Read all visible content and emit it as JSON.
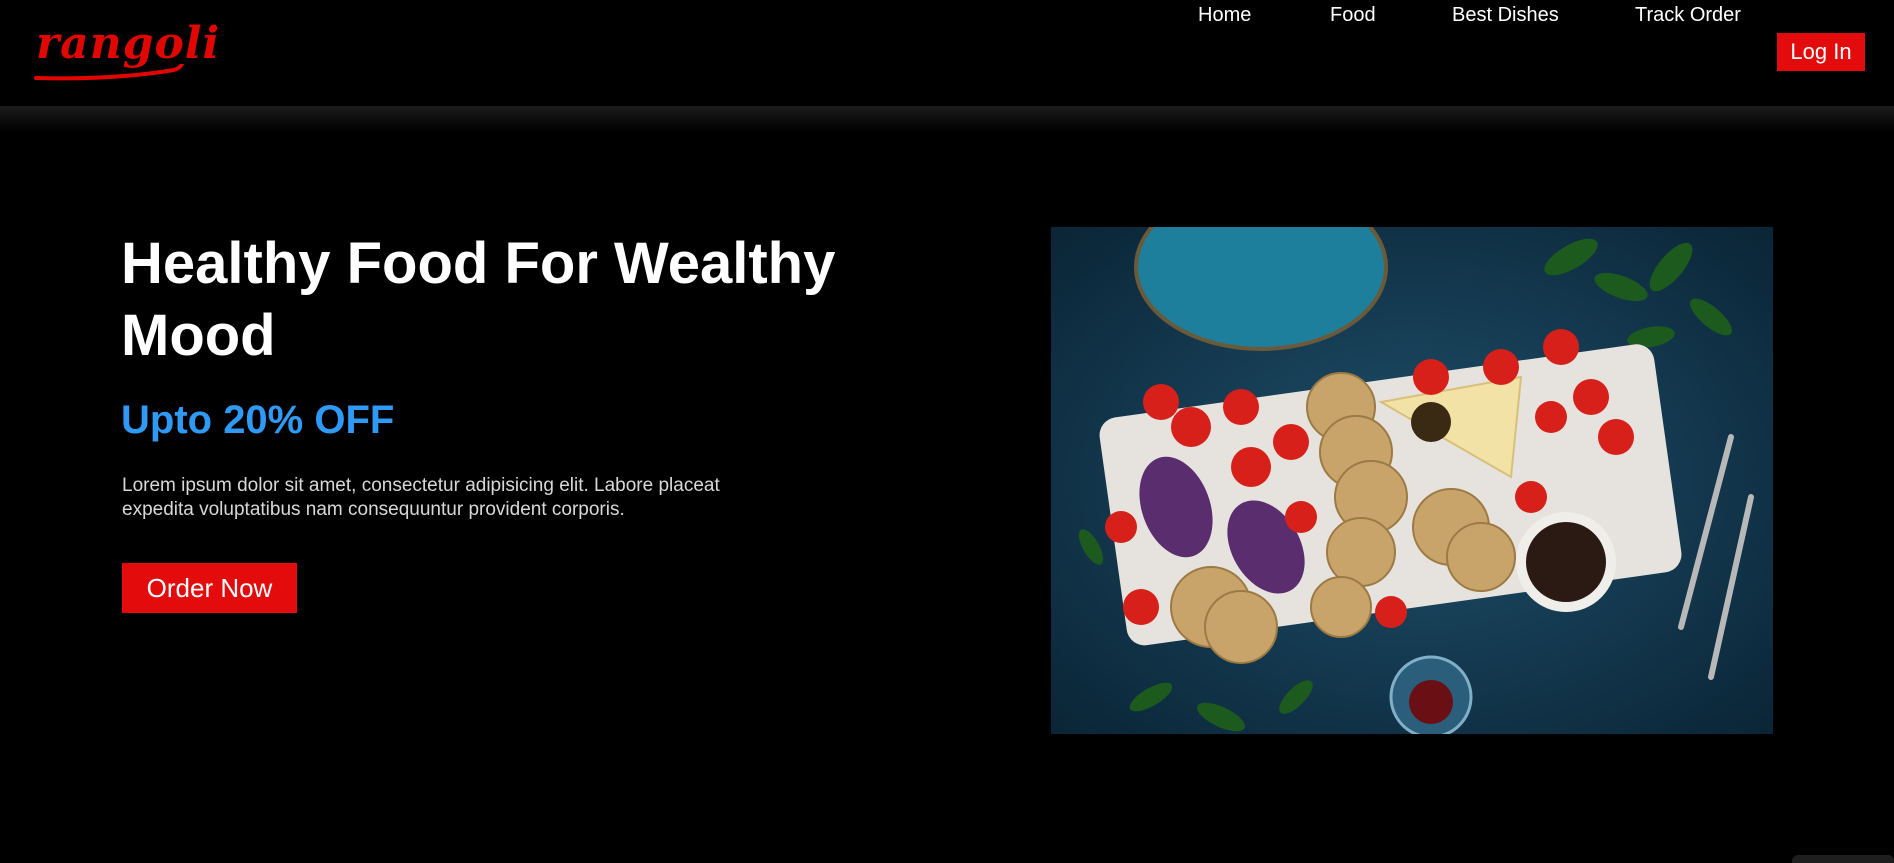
{
  "brand": {
    "logo_text": "rangoli",
    "color": "#e10600"
  },
  "nav": {
    "items": [
      {
        "label": "Home"
      },
      {
        "label": "Food"
      },
      {
        "label": "Best Dishes"
      },
      {
        "label": "Track Order"
      }
    ],
    "login_label": "Log In"
  },
  "hero": {
    "title": "Healthy Food For Wealthy Mood",
    "offer": "Upto 20% OFF",
    "description": "Lorem ipsum dolor sit amet, consectetur adipisicing elit. Labore placeat expedita voluptatibus nam consequuntur provident corporis.",
    "cta_label": "Order Now"
  },
  "colors": {
    "accent_red": "#e30b0b",
    "offer_blue": "#2f9af5",
    "background": "#000000"
  }
}
